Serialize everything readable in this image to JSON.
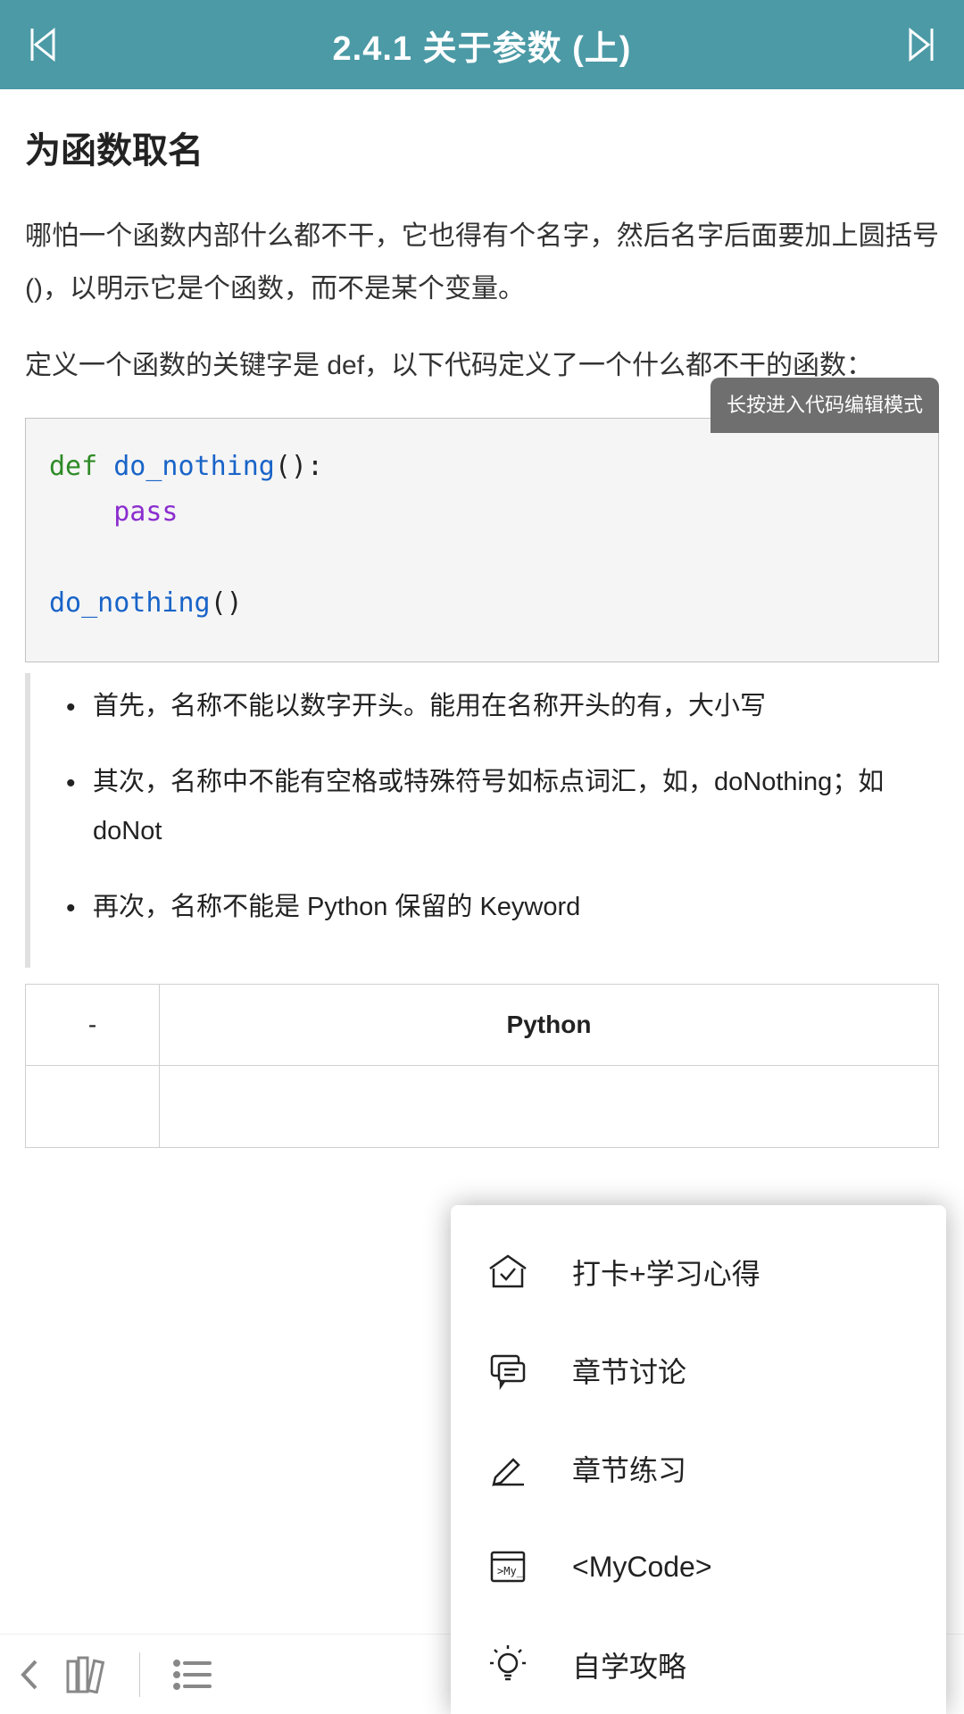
{
  "header": {
    "title": "2.4.1 关于参数 (上)"
  },
  "main": {
    "section_title": "为函数取名",
    "para1": "哪怕一个函数内部什么都不干，它也得有个名字，然后名字后面要加上圆括号 ()，以明示它是个函数，而不是某个变量。",
    "para2": "定义一个函数的关键字是 def，以下代码定义了一个什么都不干的函数：",
    "code_hint": "长按进入代码编辑模式",
    "code": {
      "kw_def": "def",
      "fn_name_def": " do_nothing",
      "parens_def": "():",
      "indent": "    ",
      "kw_pass": "pass",
      "fn_name_call": "do_nothing",
      "parens_call": "()"
    },
    "rules": [
      "首先，名称不能以数字开头。能用在名称开头的有，大小写",
      "其次，名称中不能有空格或特殊符号如标点词汇，如，doNothing；如 doNot",
      "再次，名称不能是 Python 保留的 Keyword"
    ],
    "table": {
      "col0": "-",
      "col1": "Python"
    }
  },
  "popup": {
    "items": [
      {
        "name": "checkin",
        "label": "打卡+学习心得"
      },
      {
        "name": "discussion",
        "label": "章节讨论"
      },
      {
        "name": "exercise",
        "label": "章节练习"
      },
      {
        "name": "mycode",
        "label": "<MyCode>"
      },
      {
        "name": "selfstudy",
        "label": "自学攻略"
      }
    ]
  }
}
